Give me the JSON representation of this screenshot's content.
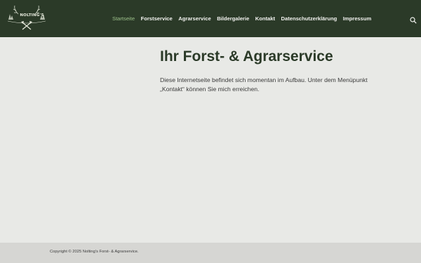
{
  "brand": {
    "logo_text": "NOLTING'S",
    "logo_icon": "crossed-axes-with-antlers"
  },
  "nav": {
    "items": [
      {
        "label": "Startseite",
        "active": true
      },
      {
        "label": "Forstservice",
        "active": false
      },
      {
        "label": "Agrarservice",
        "active": false
      },
      {
        "label": "Bildergalerie",
        "active": false
      },
      {
        "label": "Kontakt",
        "active": false
      },
      {
        "label": "Datenschutzerklärung",
        "active": false
      },
      {
        "label": "Impressum",
        "active": false
      }
    ],
    "search_icon": "search-icon"
  },
  "main": {
    "title": "Ihr Forst- & Agrarservice",
    "intro": "Diese Internetseite befindet sich momentan im Aufbau. Unter dem Menüpunkt „Kontakt“ können Sie mich erreichen."
  },
  "footer": {
    "copyright": "Copyright © 2025 Nolting's Forst- & Agrarservice."
  },
  "colors": {
    "header_bg": "#2b3a28",
    "page_bg": "#e8e9e6",
    "footer_bg": "#d6d6d3",
    "accent": "#9cc08a",
    "title": "#2b3a28"
  }
}
